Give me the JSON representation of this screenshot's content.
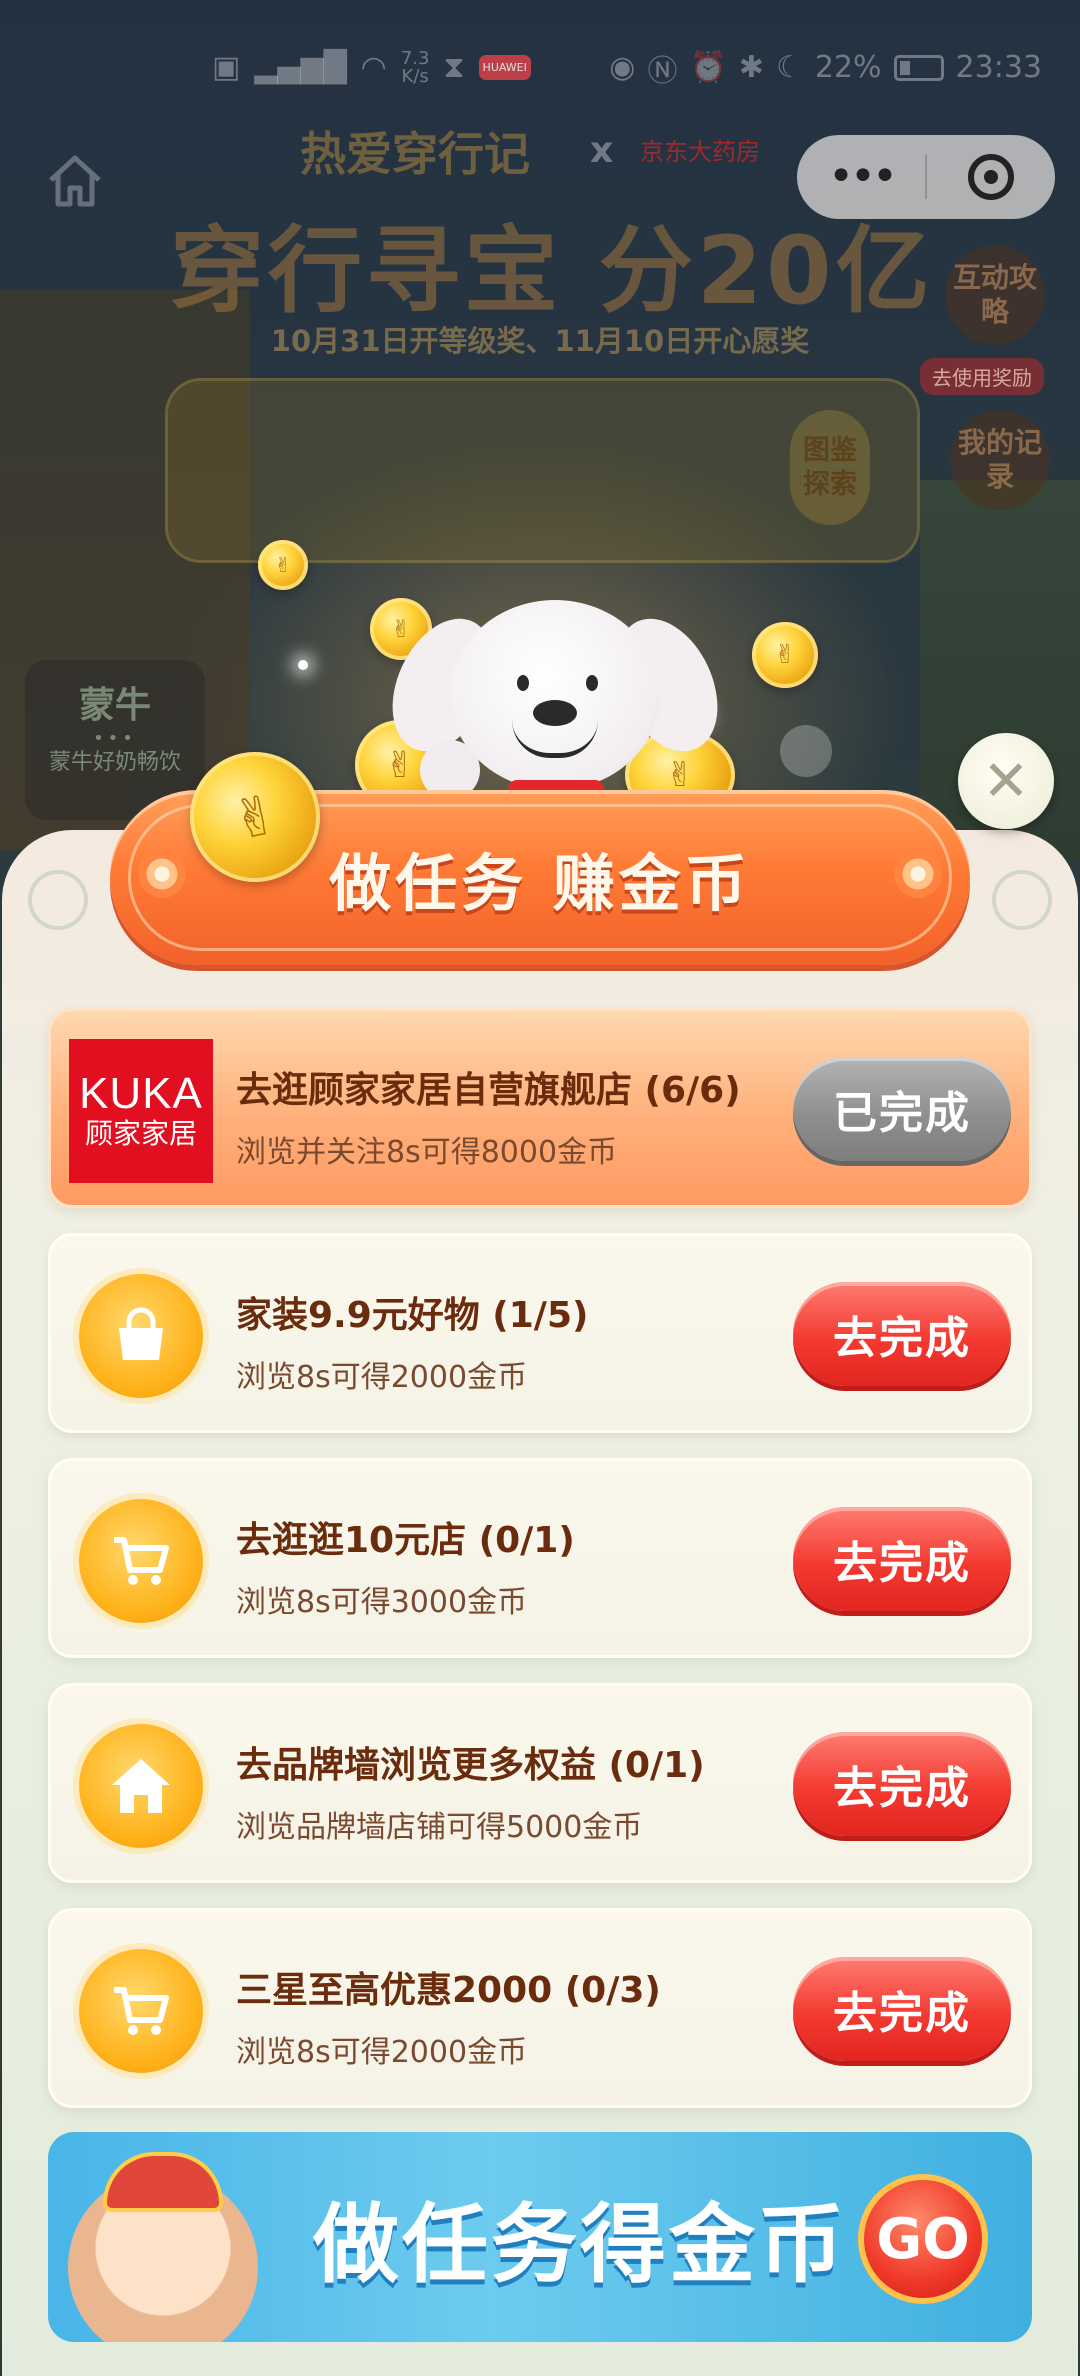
{
  "status_bar": {
    "left_icons": [
      "hd-icon",
      "signal-4g-icon",
      "wifi-icon"
    ],
    "net_speed_value": "7.3",
    "net_speed_unit": "K/s",
    "app_badge": "HUAWEI",
    "battery": "22%",
    "time": "23:33"
  },
  "background_page": {
    "title_top": "热爱穿行记",
    "x_mark": "x",
    "partner": "京东大药房",
    "title_main": "穿行寻宝 分20亿",
    "subtitle": "10月31日开等级奖、11月10日开心愿奖",
    "album_button": "图鉴探索",
    "side_buttons": [
      {
        "label": "互动攻略"
      },
      {
        "label": "我的记录"
      }
    ],
    "side_tag": "去使用奖励",
    "brand_card": {
      "logo": "蒙牛",
      "text": "蒙牛好奶畅饮"
    }
  },
  "modal": {
    "title": "做任务 赚金币",
    "close_label": "✕",
    "tasks": [
      {
        "icon": "kuka-logo",
        "brand_en": "KUKA",
        "brand_cn": "顾家家居",
        "title": "去逛顾家家居自营旗舰店 (6/6)",
        "desc": "浏览并关注8s可得8000金币",
        "button": "已完成",
        "completed": true
      },
      {
        "icon": "shopping-bag-icon",
        "title": "家装9.9元好物 (1/5)",
        "desc": "浏览8s可得2000金币",
        "button": "去完成",
        "completed": false
      },
      {
        "icon": "shopping-cart-icon",
        "title": "去逛逛10元店 (0/1)",
        "desc": "浏览8s可得3000金币",
        "button": "去完成",
        "completed": false
      },
      {
        "icon": "home-icon",
        "title": "去品牌墙浏览更多权益 (0/1)",
        "desc": "浏览品牌墙店铺可得5000金币",
        "button": "去完成",
        "completed": false
      },
      {
        "icon": "shopping-cart-icon",
        "title": "三星至高优惠2000 (0/3)",
        "desc": "浏览8s可得2000金币",
        "button": "去完成",
        "completed": false
      }
    ],
    "promo": {
      "title": "做任务得金币",
      "go": "GO"
    }
  },
  "colors": {
    "accent_orange": "#ff7a35",
    "button_red": "#f33a30",
    "button_done_gray": "#8d8d8d",
    "title_brown": "#6a2c0c"
  }
}
